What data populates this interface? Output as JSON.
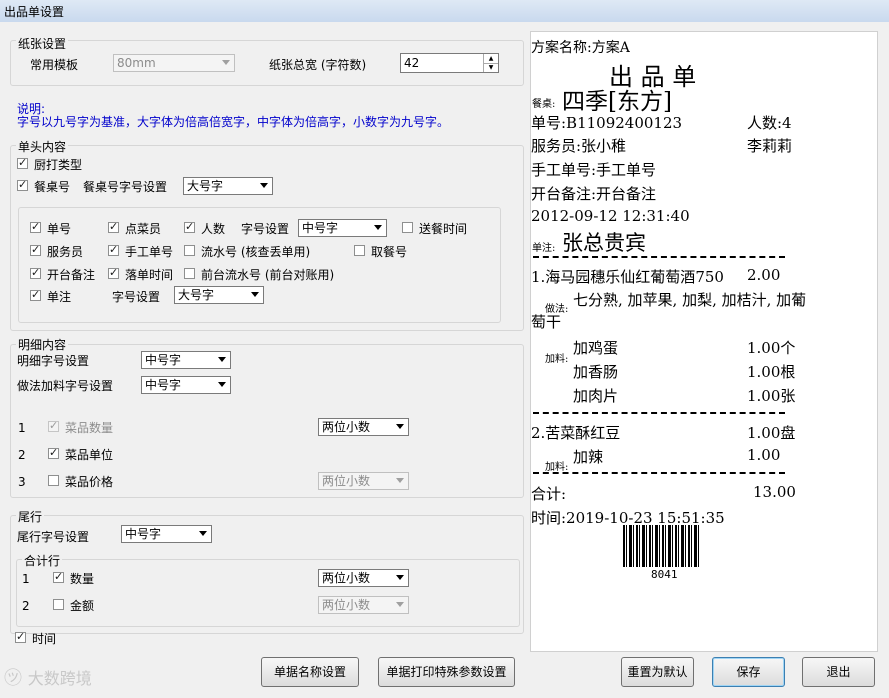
{
  "window": {
    "title": "出品单设置"
  },
  "paper": {
    "legend": "纸张设置",
    "template_label": "常用模板",
    "template_value": "80mm",
    "width_label": "纸张总宽 (字符数)",
    "width_value": "42"
  },
  "note": {
    "title": "说明:",
    "text": "字号以九号字为基准，大字体为倍高倍宽字，中字体为倍高字，小数字为九号字。"
  },
  "header": {
    "legend": "单头内容",
    "kitchen_type": "厨打类型",
    "table_no": "餐桌号",
    "table_font_label": "餐桌号字号设置",
    "table_font_value": "大号字",
    "order_no": "单号",
    "orderer": "点菜员",
    "people": "人数",
    "font_label": "字号设置",
    "font_value": "中号字",
    "delivery_time": "送餐时间",
    "waiter": "服务员",
    "manual_no": "手工单号",
    "serial_no": "流水号 (核查丢单用)",
    "pickup_no": "取餐号",
    "open_note": "开台备注",
    "order_time": "落单时间",
    "front_serial": "前台流水号 (前台对账用)",
    "remark": "单注",
    "remark_font_label": "字号设置",
    "remark_font_value": "大号字"
  },
  "detail": {
    "legend": "明细内容",
    "font_label": "明细字号设置",
    "font_value": "中号字",
    "method_font_label": "做法加料字号设置",
    "method_font_value": "中号字",
    "rows": [
      {
        "idx": "1",
        "label": "菜品数量",
        "select": "两位小数"
      },
      {
        "idx": "2",
        "label": "菜品单位"
      },
      {
        "idx": "3",
        "label": "菜品价格",
        "select": "两位小数"
      }
    ]
  },
  "footer": {
    "legend": "尾行",
    "font_label": "尾行字号设置",
    "font_value": "中号字",
    "total_legend": "合计行",
    "rows": [
      {
        "idx": "1",
        "label": "数量",
        "select": "两位小数"
      },
      {
        "idx": "2",
        "label": "金额",
        "select": "两位小数"
      }
    ],
    "time_label": "时间"
  },
  "buttons": {
    "name_setting": "单据名称设置",
    "print_param": "单据打印特殊参数设置",
    "reset": "重置为默认",
    "save": "保存",
    "exit": "退出"
  },
  "watermark": "大数跨境",
  "preview": {
    "scheme": "方案名称:方案A",
    "title": "出 品 单",
    "table_label": "餐桌:",
    "table_name": "四季[东方]",
    "order_no": "单号:B11092400123",
    "people": "人数:4",
    "waiter": "服务员:张小稚",
    "waiter2": "李莉莉",
    "manual_no": "手工单号:手工单号",
    "open_note": "开台备注:开台备注",
    "datetime": "2012-09-12 12:31:40",
    "remark_label": "单注:",
    "remark": "张总贵宾",
    "item1_name": "1.海马园穗乐仙红葡萄酒750",
    "item1_qty": "2.00",
    "method_label": "做法:",
    "method_text": "七分熟, 加苹果, 加梨, 加桔汁, 加葡",
    "method_text2": "萄干",
    "addon_label": "加料:",
    "addon1": "加鸡蛋",
    "addon1_qty": "1.00个",
    "addon2": "加香肠",
    "addon2_qty": "1.00根",
    "addon3": "加肉片",
    "addon3_qty": "1.00张",
    "item2_name": "2.苦菜酥红豆",
    "item2_qty": "1.00盘",
    "addon_label2": "加料:",
    "addon4": "加辣",
    "addon4_qty": "1.00",
    "total_label": "合计:",
    "total_value": "13.00",
    "time": "时间:2019-10-23 15:51:35",
    "barcode_no": "8041"
  }
}
